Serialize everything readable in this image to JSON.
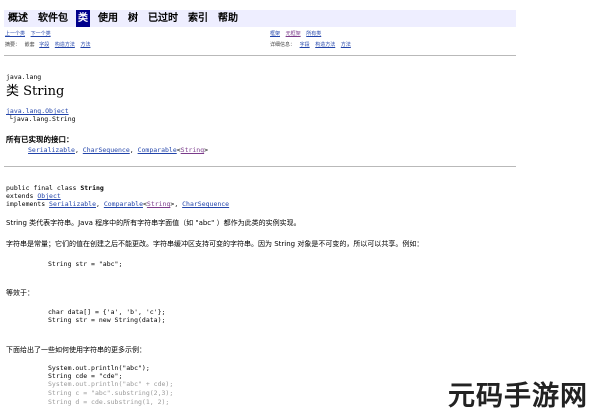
{
  "nav": {
    "items": [
      {
        "label": "概述",
        "active": false
      },
      {
        "label": "软件包",
        "active": false
      },
      {
        "label": "类",
        "active": true
      },
      {
        "label": "使用",
        "active": false
      },
      {
        "label": "树",
        "active": false
      },
      {
        "label": "已过时",
        "active": false
      },
      {
        "label": "索引",
        "active": false
      },
      {
        "label": "帮助",
        "active": false
      }
    ]
  },
  "subnav": {
    "prev_class": "上一个类",
    "next_class": "下一个类",
    "frames": "框架",
    "no_frames": "无框架",
    "all_classes": "所有类",
    "summary_label": "摘要：",
    "summary_nested": "嵌套",
    "summary_field": "字段",
    "summary_constr": "构造方法",
    "summary_method": "方法",
    "detail_label": "详细信息：",
    "detail_field": "字段",
    "detail_constr": "构造方法",
    "detail_method": "方法"
  },
  "class_header": {
    "package": "java.lang",
    "kind": "类",
    "name": "String",
    "inherit_parent": "java.lang.Object",
    "inherit_child": "java.lang.String",
    "interfaces_heading": "所有已实现的接口：",
    "interfaces": [
      {
        "name": "Serializable",
        "suffix": ", "
      },
      {
        "name": "CharSequence",
        "suffix": ", "
      },
      {
        "name": "Comparable",
        "suffix": ""
      }
    ],
    "interfaces_generic": "String",
    "interfaces_generic_open": "<",
    "interfaces_generic_close": ">"
  },
  "declaration": {
    "line1_prefix": "public final class ",
    "line1_name": "String",
    "line2_prefix": "extends ",
    "line2_link": "Object",
    "line3_prefix": "implements ",
    "line3_link1": "Serializable",
    "line3_sep1": ", ",
    "line3_link2": "Comparable",
    "line3_generic_open": "<",
    "line3_generic": "String",
    "line3_generic_close": ">",
    "line3_sep2": ", ",
    "line3_link3": "CharSequence"
  },
  "description": {
    "p1": "String 类代表字符串。Java 程序中的所有字符串字面值（如 \"abc\" ）都作为此类的实例实现。",
    "p2": "字符串是常量；它们的值在创建之后不能更改。字符串缓冲区支持可变的字符串。因为 String 对象是不可变的，所以可以共享。例如：",
    "code1": "String str = \"abc\";",
    "p3": "等效于：",
    "code2a": "char data[] = {'a', 'b', 'c'};",
    "code2b": "String str = new String(data);",
    "p4": "下面给出了一些如何使用字符串的更多示例：",
    "code3": [
      "System.out.println(\"abc\");",
      "String cde = \"cde\";",
      "System.out.println(\"abc\" + cde);",
      "String c = \"abc\".substring(2,3);",
      "String d = cde.substring(1, 2);"
    ]
  },
  "watermark": "元码手游网"
}
